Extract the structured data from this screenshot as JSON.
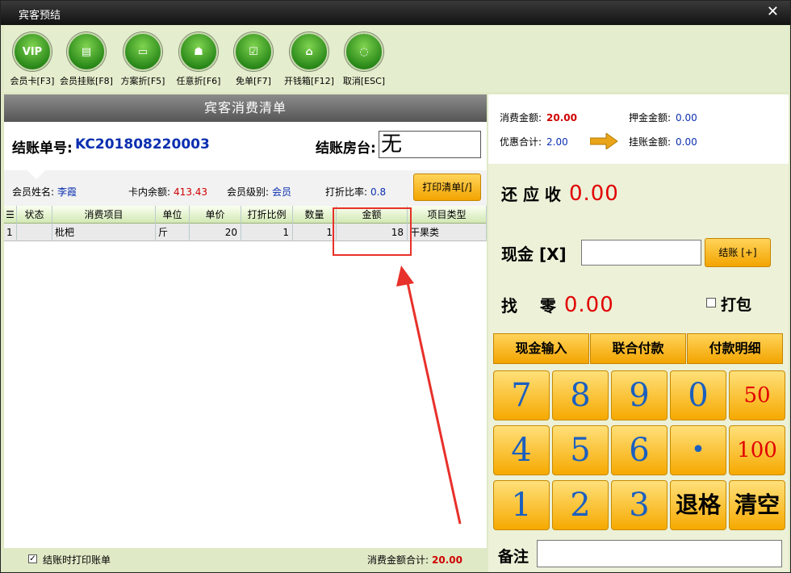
{
  "window": {
    "title": "宾客预结",
    "close": "✕"
  },
  "toolbar": [
    {
      "icon": "vip",
      "glyph": "VIP",
      "label": "会员卡[F3]"
    },
    {
      "icon": "document",
      "glyph": "▤",
      "label": "会员挂账[F8]"
    },
    {
      "icon": "tablet",
      "glyph": "▭",
      "label": "方案折[F5]"
    },
    {
      "icon": "person",
      "glyph": "☗",
      "label": "任意折[F6]"
    },
    {
      "icon": "clipboard",
      "glyph": "☑",
      "label": "免单[F7]"
    },
    {
      "icon": "cashbox",
      "glyph": "⌂",
      "label": "开钱箱[F12]"
    },
    {
      "icon": "cancel",
      "glyph": "◌",
      "label": "取消[ESC]"
    }
  ],
  "panel_title": "宾客消费清单",
  "bill": {
    "no_label": "结账单号:",
    "no": "KC201808220003",
    "room_label": "结账房台:",
    "room": "无"
  },
  "member": {
    "name_label": "会员姓名:",
    "name": "李霞",
    "balance_label": "卡内余额:",
    "balance": "413.43",
    "level_label": "会员级别:",
    "level": "会员",
    "discount_label": "打折比率:",
    "discount": "0.8",
    "print_btn": "打印清单[/]"
  },
  "table": {
    "headers": [
      "☰",
      "状态",
      "消费项目",
      "单位",
      "单价",
      "打折比例",
      "数量",
      "金额",
      "项目类型"
    ],
    "rows": [
      [
        "1",
        "",
        "枇杷",
        "斤",
        "20",
        "1",
        "1",
        "18",
        "干果类"
      ]
    ]
  },
  "footer": {
    "print_on_checkout": "结账时打印账单",
    "checked": "✓",
    "total_label": "消费金额合计:",
    "total": "20.00"
  },
  "summary": {
    "consume_label": "消费金额:",
    "consume": "20.00",
    "deposit_label": "押金金额:",
    "deposit": "0.00",
    "discount_label": "优惠合计:",
    "discount": "2.00",
    "charge_label": "挂账金额:",
    "charge": "0.00"
  },
  "payment": {
    "owe_label": "还 应 收",
    "owe": "0.00",
    "cash_label": "现金 [X]",
    "cash_value": "",
    "checkout_btn": "结账 [+]",
    "change_label": "找    零",
    "change": "0.00",
    "pack_label": "打包",
    "tabs": [
      "现金输入",
      "联合付款",
      "付款明细"
    ],
    "keys": [
      "7",
      "8",
      "9",
      "0",
      "50",
      "4",
      "5",
      "6",
      "•",
      "100",
      "1",
      "2",
      "3",
      "退格",
      "清空"
    ],
    "note_label": "备注"
  },
  "colors": {
    "accent_orange": "#f3a400",
    "amount_red": "#e10000",
    "bill_blue": "#0b2fb0",
    "bg_green": "#dfe9c6"
  }
}
